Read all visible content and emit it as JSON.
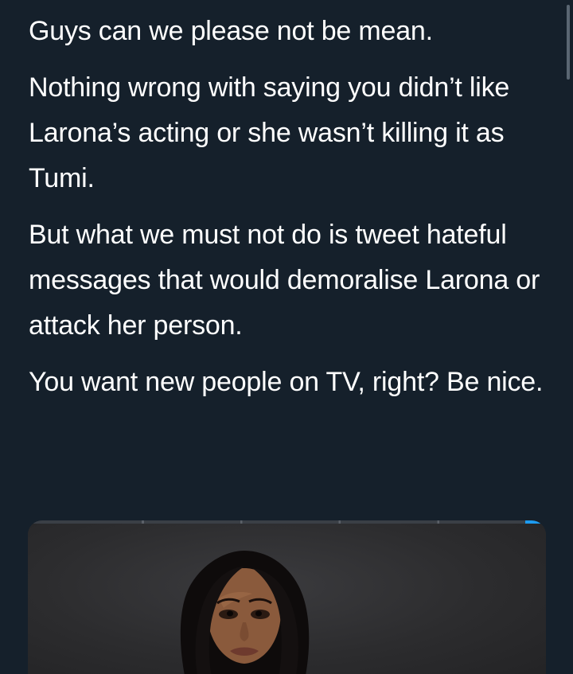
{
  "tweet": {
    "paragraphs": [
      "Guys can we please not be mean.",
      "Nothing wrong with saying you didn’t like Larona’s acting or she wasn’t killing it as Tumi.",
      "But what we must not do is tweet hateful messages that would demoralise Larona or attack her person.",
      "You want new people on TV, right? Be nice."
    ]
  },
  "media": {
    "type": "photo",
    "subject": "portrait"
  },
  "colors": {
    "background": "#15202b",
    "text": "#ffffff",
    "accent": "#1d9bf0"
  }
}
